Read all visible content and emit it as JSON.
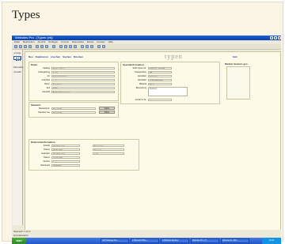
{
  "heading": "Types",
  "window": {
    "title": "Websites Pro - [Typen (ef)]"
  },
  "menu": [
    "Datei",
    "Bearbeiten",
    "Ansicht",
    "Einfügen",
    "Format",
    "Datensätze",
    "Extras",
    "Fenster",
    "Hilfe"
  ],
  "nav": [
    "Anzeige",
    "",
    "Datensätze",
    "Auswahl"
  ],
  "form": {
    "toolbar": [
      "Neu",
      "Duplizieren",
      "Löschen",
      "Suchen",
      "Drucken"
    ],
    "title": "typen",
    "exit": "Exit",
    "sections": {
      "daten": {
        "header": "Daten",
        "rows": [
          {
            "label": "Katalog",
            "value": "Baubeschlage"
          },
          {
            "label": "Untergattung",
            "value": "Gerät"
          },
          {
            "label": "Art",
            "value": "Scharnierbänder"
          },
          {
            "label": "Untertitel",
            "value": ""
          },
          {
            "label": "Dekor",
            "value": "Sandguss"
          },
          {
            "label": "Zeit",
            "value": "1900"
          },
          {
            "label": "Auswahl",
            "value": "Barthold Stein gasse"
          }
        ]
      },
      "standort": {
        "header": "Standort",
        "rows": [
          {
            "label": "Bestand-Nr.",
            "value": "Bre A0377"
          },
          {
            "label": "Standort neu",
            "value": "ED 4T 407",
            "button": "Wähle"
          }
        ],
        "button": "Wähle"
      },
      "spezial": {
        "header": "Spezialinformation",
        "rows": [
          {
            "label": "SUB-Typen-Nr.",
            "value": "STM-ZYL-S0045T"
          },
          {
            "label": "Preisposition",
            "value": "PB"
          },
          {
            "label": "Hersteller",
            "value": "Scharnier"
          },
          {
            "label": "Hersteller",
            "value": "JASPI BENTON"
          },
          {
            "label": "Material",
            "value": "Eisen"
          },
          {
            "label": "Bemerkung",
            "value": "Bestand"
          },
          {
            "label": "Anzahl & St.",
            "value": ""
          }
        ]
      },
      "media": {
        "header": "Medien-Verweis ges."
      },
      "zeit": {
        "header": "Datensatzinformation",
        "rows": [
          {
            "label": "Erstellt",
            "value": "Olaf Dörenfell"
          },
          {
            "label": "Datum",
            "value": "05.05.2006"
          },
          {
            "label": "Geändert",
            "value": "Olaf Dörenfell"
          },
          {
            "label": "Datum",
            "value": "02.08.2006"
          },
          {
            "label": "Version",
            "value": "1"
          },
          {
            "label": "Datensatz",
            "value": "00065645"
          }
        ],
        "right": [
          "Baumeister",
          "Sperre b",
          "Gebr."
        ]
      }
    }
  },
  "status": {
    "record": "Datensatz: 1 von 1",
    "mode": "Formularansicht"
  },
  "taskbar": {
    "start": "start",
    "tasks": [
      "SAP Gateway Ano...",
      "2 Microsoft Office...",
      "2 Windows Explorer",
      "Websites Pro - [T...",
      "Dokument1 - Micr..."
    ],
    "clock": "10:42"
  }
}
